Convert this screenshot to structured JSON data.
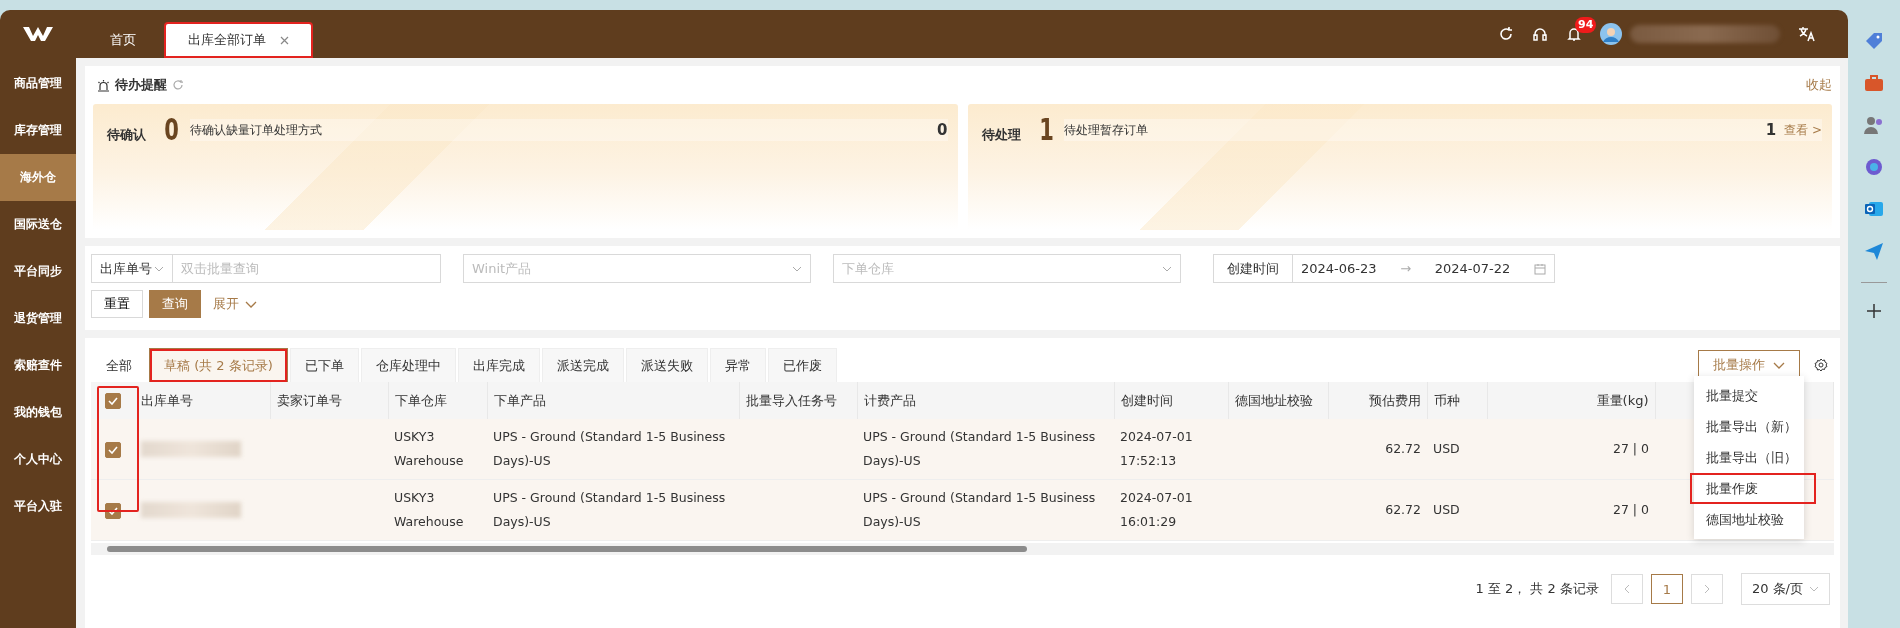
{
  "top_bar": {
    "tabs": [
      {
        "label": "首页",
        "selected": false,
        "closable": false,
        "highlighted": false
      },
      {
        "label": "出库全部订单",
        "selected": true,
        "closable": true,
        "highlighted": true
      }
    ],
    "notification_count": "94"
  },
  "sidebar": {
    "items": [
      {
        "label": "商品管理",
        "selected": false
      },
      {
        "label": "库存管理",
        "selected": false
      },
      {
        "label": "海外仓",
        "selected": true
      },
      {
        "label": "国际送仓",
        "selected": false
      },
      {
        "label": "平台同步",
        "selected": false
      },
      {
        "label": "退货管理",
        "selected": false
      },
      {
        "label": "索赔查件",
        "selected": false
      },
      {
        "label": "我的钱包",
        "selected": false
      },
      {
        "label": "个人中心",
        "selected": false
      },
      {
        "label": "平台入驻",
        "selected": false
      }
    ]
  },
  "reminders": {
    "title": "待办提醒",
    "collapse": "收起",
    "cards": [
      {
        "label": "待确认",
        "count": "0",
        "task": "待确认缺量订单处理方式",
        "task_count": "0"
      },
      {
        "label": "待处理",
        "count": "1",
        "task": "待处理暂存订单",
        "task_count": "1",
        "link": "查看 >"
      }
    ]
  },
  "filters": {
    "field_select": "出库单号",
    "search_placeholder": "双击批量查询",
    "product_placeholder": "Winit产品",
    "warehouse_placeholder": "下单仓库",
    "date_label": "创建时间",
    "date_from": "2024-06-23",
    "date_arrow": "→",
    "date_to": "2024-07-22",
    "reset": "重置",
    "query": "查询",
    "expand": "展开"
  },
  "status_tabs": [
    {
      "label": "全部",
      "selected": false,
      "highlighted": false
    },
    {
      "label": "草稿 (共 2 条记录)",
      "selected": true,
      "highlighted": true
    },
    {
      "label": "已下单",
      "selected": false,
      "highlighted": false
    },
    {
      "label": "仓库处理中",
      "selected": false,
      "highlighted": false
    },
    {
      "label": "出库完成",
      "selected": false,
      "highlighted": false
    },
    {
      "label": "派送完成",
      "selected": false,
      "highlighted": false
    },
    {
      "label": "派送失败",
      "selected": false,
      "highlighted": false
    },
    {
      "label": "异常",
      "selected": false,
      "highlighted": false
    },
    {
      "label": "已作废",
      "selected": false,
      "highlighted": false
    }
  ],
  "batch_button": "批量操作",
  "batch_menu": [
    {
      "label": "批量提交",
      "highlighted": false
    },
    {
      "label": "批量导出（新）",
      "highlighted": false
    },
    {
      "label": "批量导出（旧）",
      "highlighted": false
    },
    {
      "label": "批量作废",
      "highlighted": true
    },
    {
      "label": "德国地址校验",
      "highlighted": false
    }
  ],
  "table": {
    "select_all_checked": true,
    "checkbox_column_highlighted": true,
    "columns": [
      "出库单号",
      "卖家订单号",
      "下单仓库",
      "下单产品",
      "批量导入任务号",
      "计费产品",
      "创建时间",
      "德国地址校验",
      "预估费用",
      "币种",
      "重量(kg)"
    ],
    "rows": [
      {
        "checked": true,
        "warehouse": "USKY3 Warehouse",
        "product": "UPS - Ground (Standard 1-5 Business Days)-US",
        "billing_product": "UPS - Ground (Standard 1-5 Business Days)-US",
        "created": "2024-07-01 17:52:13",
        "fee": "62.72",
        "currency": "USD",
        "weight": "27 | 0"
      },
      {
        "checked": true,
        "warehouse": "USKY3 Warehouse",
        "product": "UPS - Ground (Standard 1-5 Business Days)-US",
        "billing_product": "UPS - Ground (Standard 1-5 Business Days)-US",
        "created": "2024-07-01 16:01:29",
        "fee": "62.72",
        "currency": "USD",
        "weight": "27 | 0"
      }
    ]
  },
  "pagination": {
    "summary": "1 至 2， 共 2 条记录",
    "pages": [
      {
        "label": "1",
        "selected": true
      }
    ],
    "page_size": "20 条/页"
  }
}
